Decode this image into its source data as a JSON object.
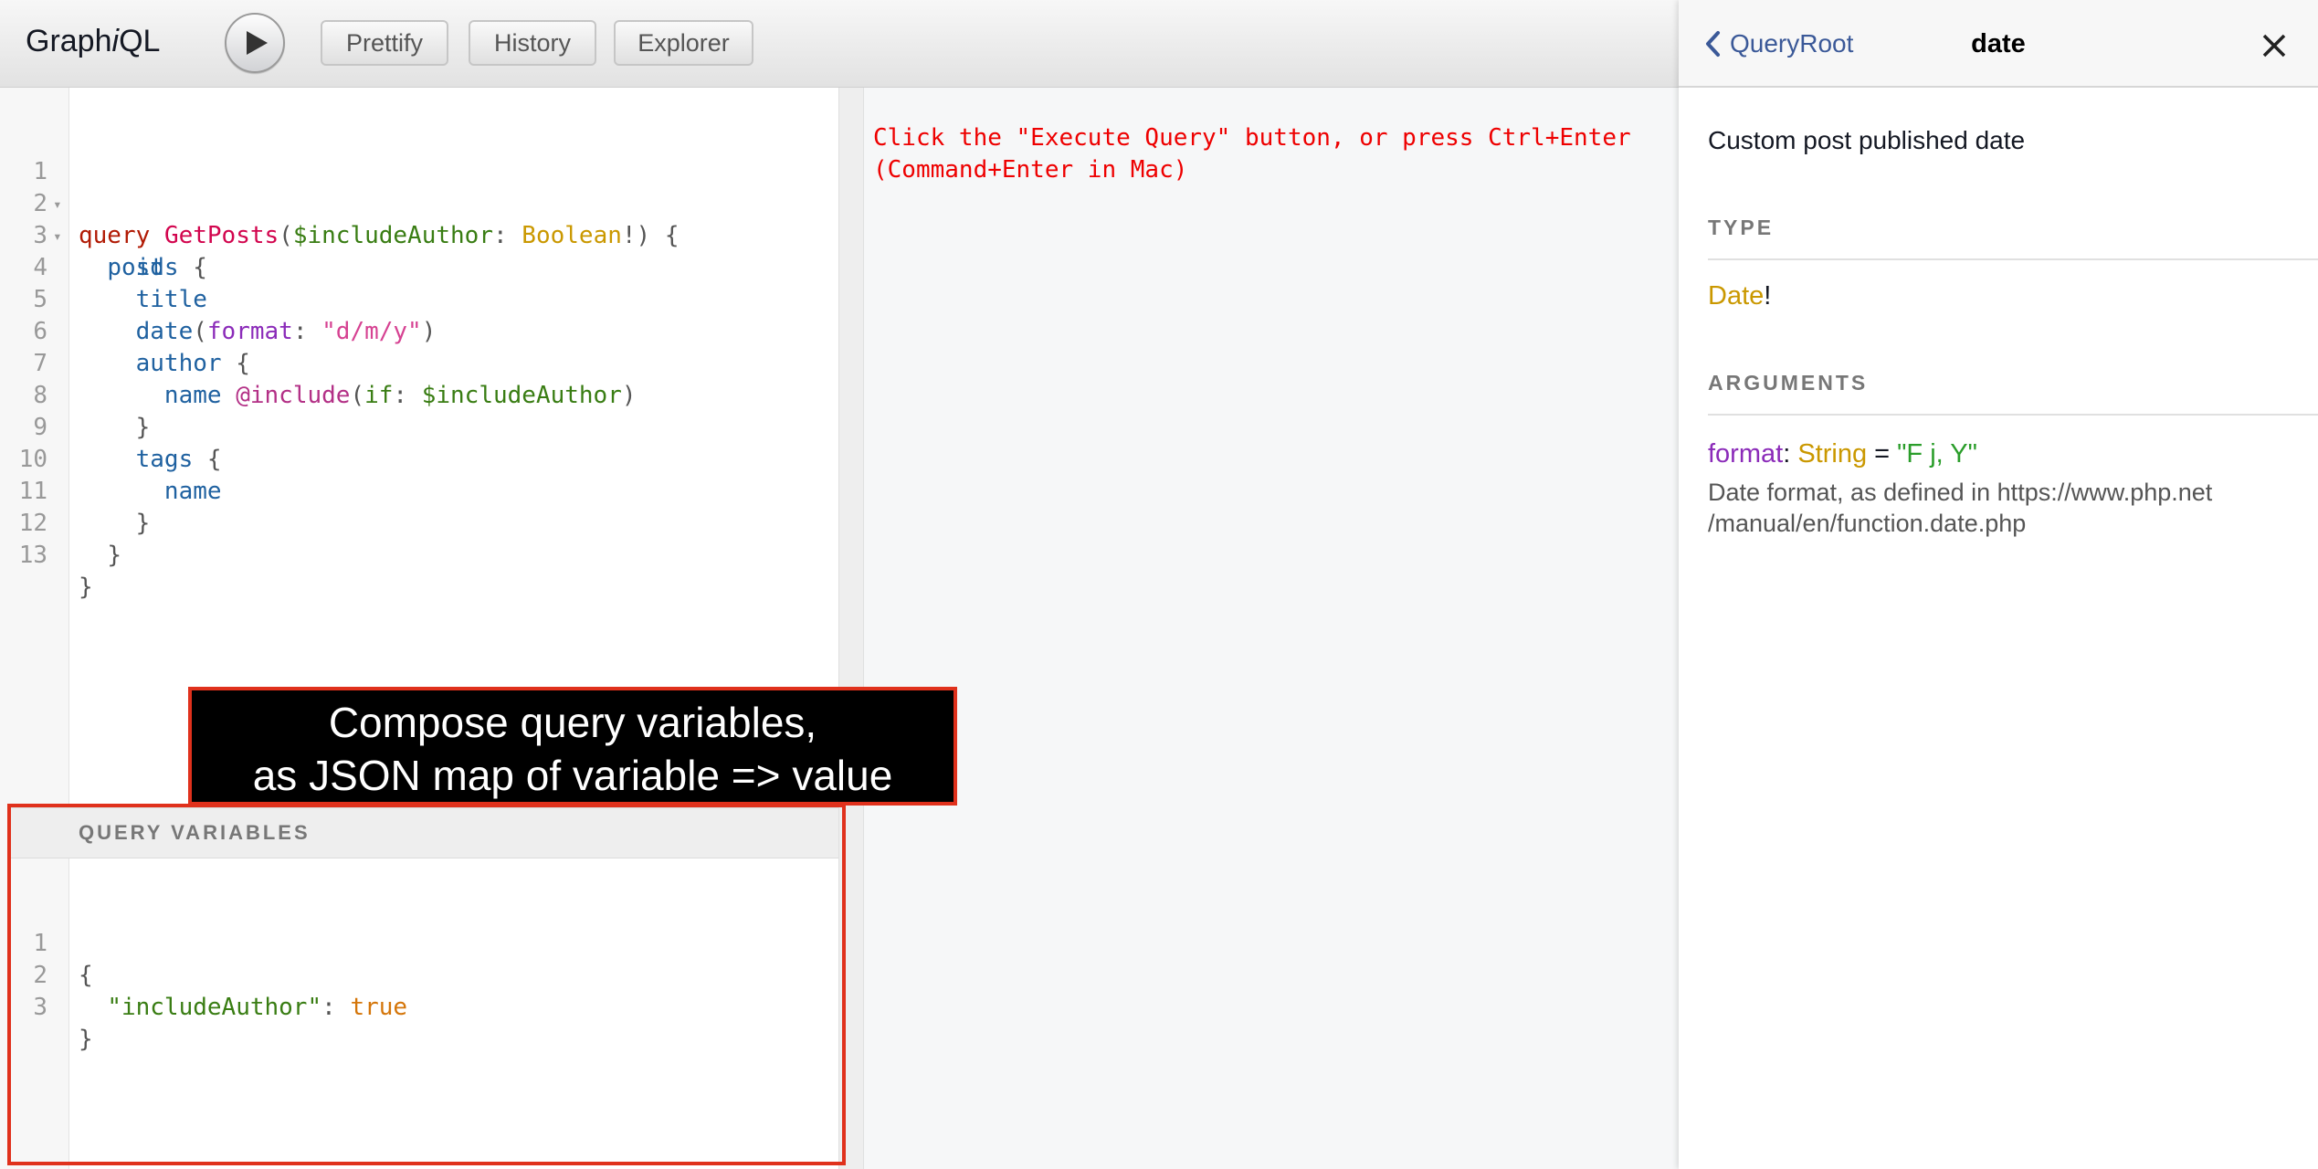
{
  "toolbar": {
    "logo_prefix": "Graph",
    "logo_italic": "i",
    "logo_suffix": "QL",
    "execute_icon": "play-icon",
    "prettify_label": "Prettify",
    "history_label": "History",
    "explorer_label": "Explorer"
  },
  "query_editor": {
    "lines": [
      {
        "n": "1",
        "fold": "▾"
      },
      {
        "n": "2",
        "fold": "▾"
      },
      {
        "n": "3"
      },
      {
        "n": "4"
      },
      {
        "n": "5"
      },
      {
        "n": "6"
      },
      {
        "n": "7"
      },
      {
        "n": "8"
      },
      {
        "n": "9"
      },
      {
        "n": "10"
      },
      {
        "n": "11"
      },
      {
        "n": "12"
      },
      {
        "n": "13"
      }
    ],
    "tokens": {
      "l1_kw": "query",
      "l1_name": "GetPosts",
      "l1_open": "(",
      "l1_var": "$includeAuthor",
      "l1_colon": ": ",
      "l1_type": "Boolean",
      "l1_close": "!) {",
      "l2_field": "posts",
      "l2_brace": " {",
      "l3_field": "id",
      "l4_field": "title",
      "l5_field": "date",
      "l5_open": "(",
      "l5_arg": "format",
      "l5_colon": ": ",
      "l5_str": "\"d/m/y\"",
      "l5_close": ")",
      "l6_field": "author",
      "l6_brace": " {",
      "l7_field": "name",
      "l7_dir": "@include",
      "l7_open": "(",
      "l7_arg": "if",
      "l7_colon": ": ",
      "l7_var": "$includeAuthor",
      "l7_close": ")",
      "l8_brace": "}",
      "l9_field": "tags",
      "l9_brace": " {",
      "l10_field": "name",
      "l11_brace": "}",
      "l12_brace": "}",
      "l13_brace": "}"
    }
  },
  "result_pane": {
    "hint_line1": "Click the \"Execute Query\" button, or press Ctrl+Enter",
    "hint_line2": "(Command+Enter in Mac)"
  },
  "variables": {
    "header": "QUERY VARIABLES",
    "line_numbers": [
      "1",
      "2",
      "3"
    ],
    "l1": "{",
    "l2_key": "\"includeAuthor\"",
    "l2_colon": ": ",
    "l2_value": "true",
    "l3": "}"
  },
  "callout": {
    "line1": "Compose query variables,",
    "line2": "as JSON map of variable => value"
  },
  "docs": {
    "back_label": "QueryRoot",
    "title": "date",
    "description": "Custom post published date",
    "type_section": "TYPE",
    "type_name": "Date",
    "type_suffix": "!",
    "arguments_section": "ARGUMENTS",
    "arg_name": "format",
    "arg_colon": ": ",
    "arg_type": "String",
    "arg_equals": " = ",
    "arg_default": "\"F j, Y\"",
    "arg_desc_line1": "Date format, as defined in https://www.php.net",
    "arg_desc_line2": "/manual/en/function.date.php"
  },
  "colors": {
    "keyword": "#b11a04",
    "definition": "#d2054e",
    "variable": "#397d13",
    "type": "#ca9800",
    "field": "#1f61a0",
    "argument": "#8b2bb9",
    "string": "#d64292",
    "highlight_border": "#e0311c",
    "link": "#3b5998"
  }
}
